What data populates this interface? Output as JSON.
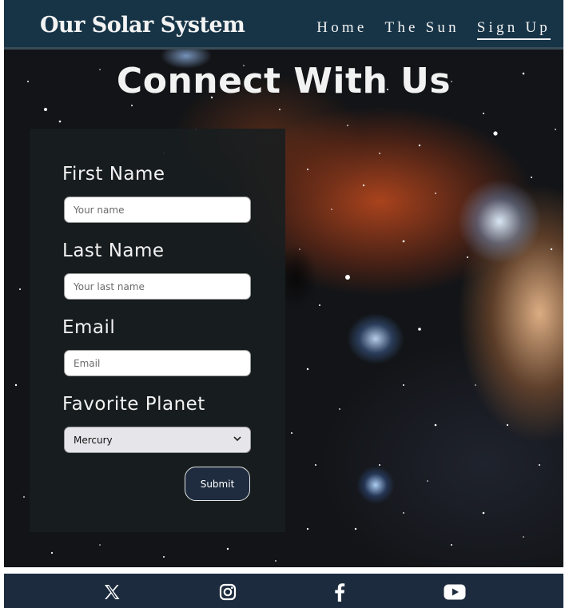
{
  "header": {
    "logo": "Our Solar System",
    "nav": [
      {
        "label": "Home",
        "active": false
      },
      {
        "label": "The Sun",
        "active": false
      },
      {
        "label": "Sign Up",
        "active": true
      }
    ]
  },
  "main": {
    "title": "Connect With Us",
    "form": {
      "first_name": {
        "label": "First Name",
        "placeholder": "Your name"
      },
      "last_name": {
        "label": "Last Name",
        "placeholder": "Your last name"
      },
      "email": {
        "label": "Email",
        "placeholder": "Email"
      },
      "planet": {
        "label": "Favorite Planet",
        "selected": "Mercury"
      },
      "submit_label": "Submit"
    }
  },
  "footer": {
    "social_icons": [
      "x-icon",
      "instagram-icon",
      "facebook-icon",
      "youtube-icon"
    ]
  },
  "colors": {
    "header_bg": "#173447",
    "footer_bg": "#1c2b3d",
    "button_bg": "#1f2c3f",
    "text_light": "#f2f2f2"
  }
}
